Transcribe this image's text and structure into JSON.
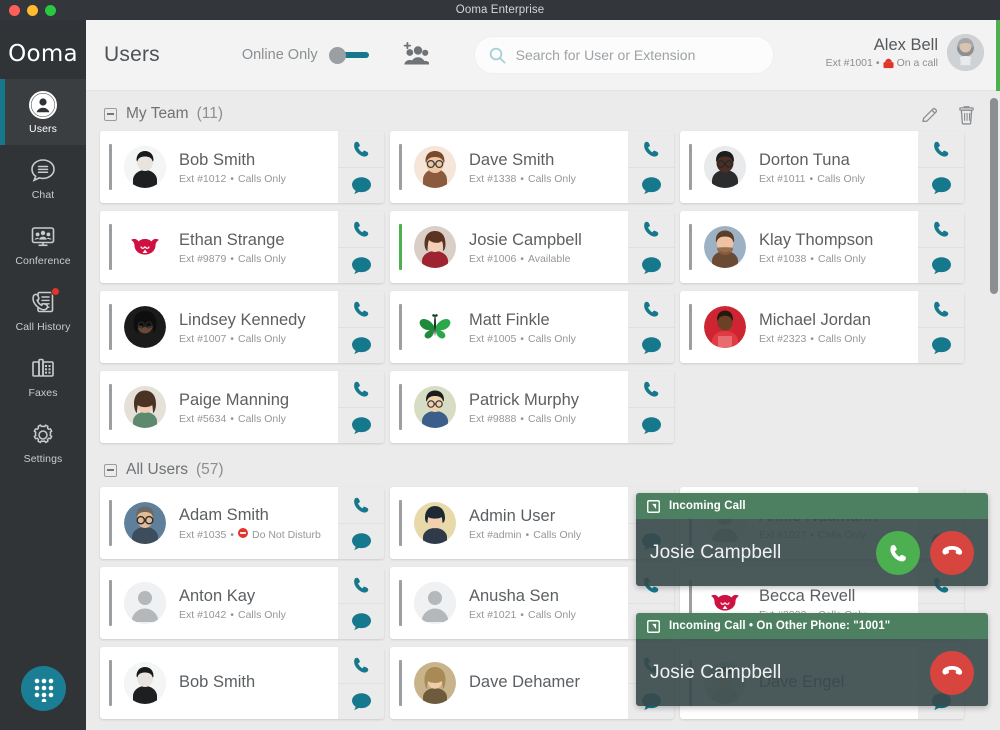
{
  "window": {
    "title": "Ooma Enterprise",
    "traffic_lights": [
      "close",
      "minimize",
      "zoom"
    ]
  },
  "sidebar": {
    "logo": "Ooma",
    "items": [
      {
        "label": "Users",
        "icon": "user-circle-icon",
        "active": true,
        "badge": false
      },
      {
        "label": "Chat",
        "icon": "chat-bubble-icon",
        "active": false,
        "badge": false
      },
      {
        "label": "Conference",
        "icon": "conference-icon",
        "active": false,
        "badge": false
      },
      {
        "label": "Call History",
        "icon": "call-history-icon",
        "active": false,
        "badge": true
      },
      {
        "label": "Faxes",
        "icon": "fax-icon",
        "active": false,
        "badge": false
      },
      {
        "label": "Settings",
        "icon": "gear-icon",
        "active": false,
        "badge": false
      }
    ],
    "dialpad_label": "dialpad"
  },
  "header": {
    "title": "Users",
    "online_only_label": "Online Only",
    "online_only_on": false,
    "add_group_label": "add-group",
    "search": {
      "placeholder": "Search for User or Extension",
      "value": ""
    },
    "me": {
      "name": "Alex Bell",
      "extension": "Ext #1001",
      "separator": "•",
      "status": "On a call",
      "status_color": "#4caf50"
    }
  },
  "sections": [
    {
      "title": "My Team",
      "count": "(11)",
      "collapsed": false,
      "actions": [
        {
          "name": "edit-team-button",
          "icon": "pencil-icon"
        },
        {
          "name": "delete-team-button",
          "icon": "trash-icon"
        }
      ],
      "users": [
        {
          "name": "Bob Smith",
          "ext": "Ext #1012",
          "status": "Calls Only",
          "avatar": "photo-male-dark",
          "presence": "offline",
          "dnd": false
        },
        {
          "name": "Dave Smith",
          "ext": "Ext #1338",
          "status": "Calls Only",
          "avatar": "photo-male-glasses",
          "presence": "offline",
          "dnd": false
        },
        {
          "name": "Dorton Tuna",
          "ext": "Ext #1011",
          "status": "Calls Only",
          "avatar": "photo-male-dark2",
          "presence": "offline",
          "dnd": false
        },
        {
          "name": "Ethan Strange",
          "ext": "Ext #9879",
          "status": "Calls Only",
          "avatar": "bull-logo",
          "presence": "offline",
          "dnd": false
        },
        {
          "name": "Josie Campbell",
          "ext": "Ext #1006",
          "status": "Available",
          "avatar": "photo-female-red",
          "presence": "available",
          "dnd": false
        },
        {
          "name": "Klay Thompson",
          "ext": "Ext #1038",
          "status": "Calls Only",
          "avatar": "photo-male-beard",
          "presence": "offline",
          "dnd": false
        },
        {
          "name": "Lindsey Kennedy",
          "ext": "Ext #1007",
          "status": "Calls Only",
          "avatar": "photo-female-dark",
          "presence": "offline",
          "dnd": false
        },
        {
          "name": "Matt Finkle",
          "ext": "Ext #1005",
          "status": "Calls Only",
          "avatar": "butterfly-logo",
          "presence": "offline",
          "dnd": false
        },
        {
          "name": "Michael Jordan",
          "ext": "Ext #2323",
          "status": "Calls Only",
          "avatar": "photo-athlete-red",
          "presence": "offline",
          "dnd": false
        },
        {
          "name": "Paige Manning",
          "ext": "Ext #5634",
          "status": "Calls Only",
          "avatar": "photo-female-curly",
          "presence": "offline",
          "dnd": false
        },
        {
          "name": "Patrick Murphy",
          "ext": "Ext #9888",
          "status": "Calls Only",
          "avatar": "photo-male-asian",
          "presence": "offline",
          "dnd": false
        }
      ]
    },
    {
      "title": "All Users",
      "count": "(57)",
      "collapsed": false,
      "actions": [],
      "users": [
        {
          "name": "Adam Smith",
          "ext": "Ext #1035",
          "status": "Do Not Disturb",
          "avatar": "photo-male-glasses2",
          "presence": "offline",
          "dnd": true
        },
        {
          "name": "Admin User",
          "ext": "Ext #admin",
          "status": "Calls Only",
          "avatar": "photo-female-short",
          "presence": "offline",
          "dnd": false
        },
        {
          "name": "Annie Naumann",
          "ext": "Ext #1027",
          "status": "Calls Only",
          "avatar": "placeholder-person",
          "presence": "offline",
          "dnd": false
        },
        {
          "name": "Anton Kay",
          "ext": "Ext #1042",
          "status": "Calls Only",
          "avatar": "placeholder-person",
          "presence": "offline",
          "dnd": false
        },
        {
          "name": "Anusha Sen",
          "ext": "Ext #1021",
          "status": "Calls Only",
          "avatar": "placeholder-person",
          "presence": "offline",
          "dnd": false
        },
        {
          "name": "Becca Revell",
          "ext": "Ext #2222",
          "status": "Calls Only",
          "avatar": "bull-logo",
          "presence": "offline",
          "dnd": false
        },
        {
          "name": "Bob Smith",
          "ext": "",
          "status": "",
          "avatar": "photo-male-dark",
          "presence": "offline",
          "dnd": false
        },
        {
          "name": "Dave Dehamer",
          "ext": "",
          "status": "",
          "avatar": "photo-female-blonde",
          "presence": "offline",
          "dnd": false
        },
        {
          "name": "Dave Engel",
          "ext": "",
          "status": "",
          "avatar": "photo-male-young",
          "presence": "offline",
          "dnd": false
        }
      ]
    }
  ],
  "card_actions": {
    "call_label": "call",
    "chat_label": "chat"
  },
  "toasts": [
    {
      "id": "toast-1",
      "header": "Incoming Call",
      "caller": "Josie Campbell",
      "expand_icon": "expand-icon",
      "accept": true,
      "accept_label": "answer-call",
      "decline_label": "decline-call"
    },
    {
      "id": "toast-2",
      "header": "Incoming Call • On Other Phone: \"1001\"",
      "caller": "Josie Campbell",
      "expand_icon": "expand-icon",
      "accept": false,
      "accept_label": "answer-call",
      "decline_label": "decline-call"
    }
  ],
  "colors": {
    "accent_teal": "#16788c",
    "sidebar_bg": "#313437",
    "available_green": "#4caf50",
    "dnd_red": "#e0352b",
    "toast_header_green": "#4c8060",
    "decline_red": "#d8453f"
  },
  "scroll": {
    "position_percent": 0
  }
}
